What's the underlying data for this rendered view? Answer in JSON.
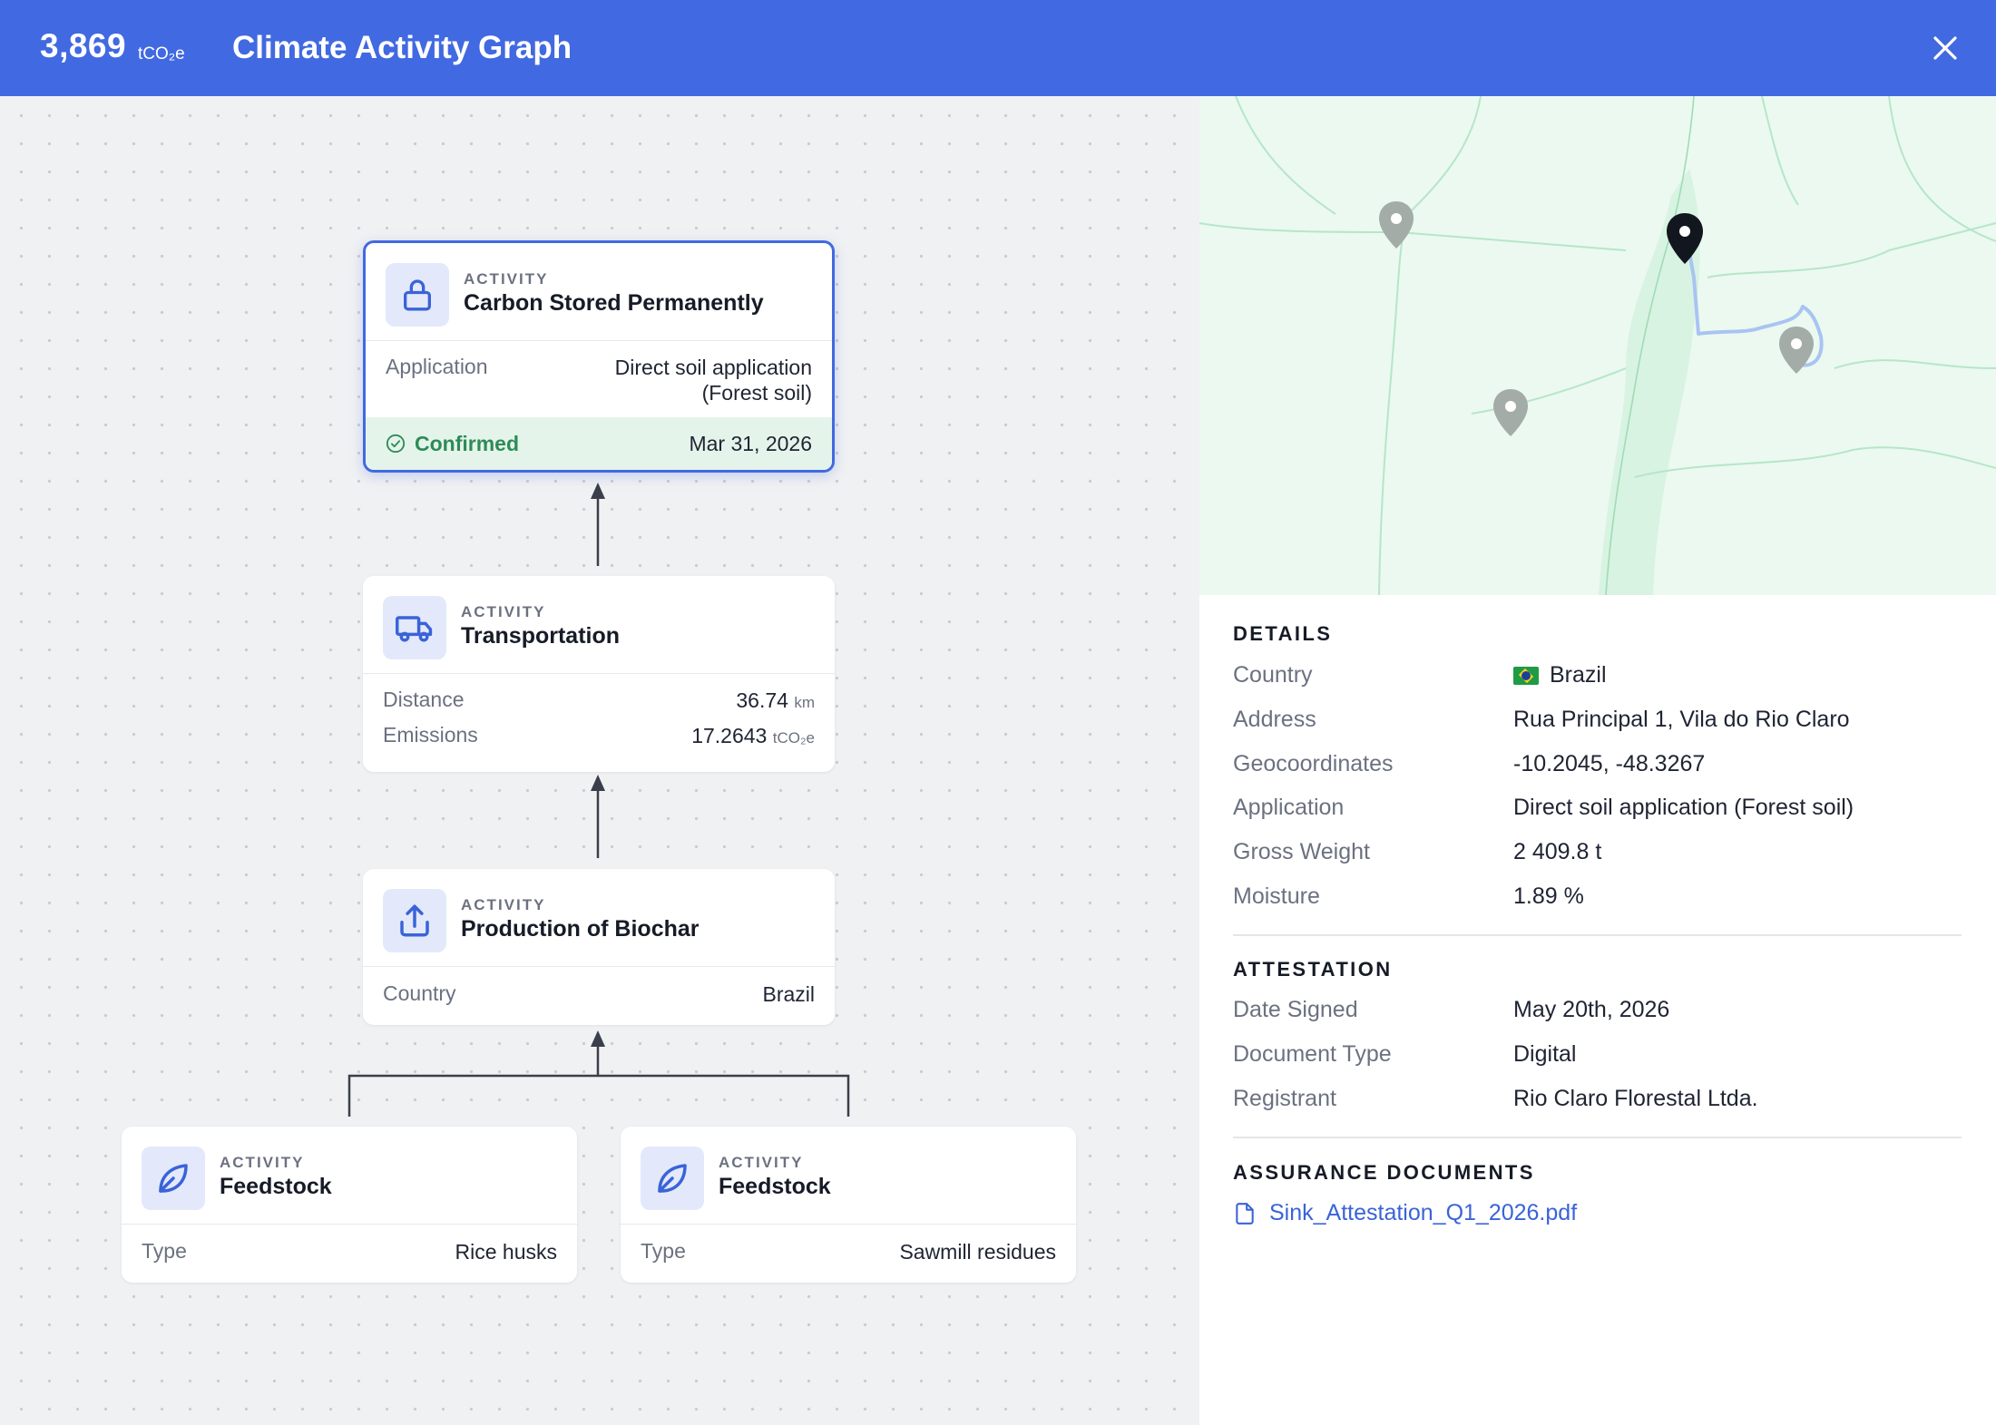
{
  "header": {
    "total_value": "3,869",
    "total_unit": "tCO₂e",
    "title": "Climate Activity Graph",
    "close_icon": "close-icon"
  },
  "colors": {
    "header_bg": "#4169e1",
    "accent": "#4169e1",
    "confirmed": "#2e8b57",
    "link": "#3a63d8"
  },
  "graph": {
    "kicker": "ACTIVITY",
    "nodes": {
      "carbon": {
        "title": "Carbon Stored Permanently",
        "icon": "lock-icon",
        "row_label": "Application",
        "row_value_line1": "Direct soil application",
        "row_value_line2": "(Forest soil)",
        "status": "Confirmed",
        "status_icon": "check-circle-icon",
        "date": "Mar 31, 2026"
      },
      "transport": {
        "title": "Transportation",
        "icon": "truck-icon",
        "distance_label": "Distance",
        "distance_value": "36.74",
        "distance_unit": "km",
        "emissions_label": "Emissions",
        "emissions_value": "17.2643",
        "emissions_unit": "tCO₂e"
      },
      "biochar": {
        "title": "Production of Biochar",
        "icon": "upload-icon",
        "row_label": "Country",
        "row_value": "Brazil"
      },
      "feedstock_1": {
        "title": "Feedstock",
        "icon": "leaf-icon",
        "row_label": "Type",
        "row_value": "Rice husks"
      },
      "feedstock_2": {
        "title": "Feedstock",
        "icon": "leaf-icon",
        "row_label": "Type",
        "row_value": "Sawmill residues"
      }
    }
  },
  "details": {
    "title": "DETAILS",
    "country_label": "Country",
    "country_value": "Brazil",
    "address_label": "Address",
    "address_value": "Rua Principal 1, Vila do Rio Claro",
    "geo_label": "Geocoordinates",
    "geo_value": "-10.2045, -48.3267",
    "application_label": "Application",
    "application_value": "Direct soil application (Forest soil)",
    "weight_label": "Gross Weight",
    "weight_value": "2 409.8 t",
    "moisture_label": "Moisture",
    "moisture_value": "1.89 %"
  },
  "attestation": {
    "title": "ATTESTATION",
    "date_label": "Date Signed",
    "date_value": "May 20th, 2026",
    "doctype_label": "Document Type",
    "doctype_value": "Digital",
    "registrant_label": "Registrant",
    "registrant_value": "Rio Claro Florestal Ltda."
  },
  "assurance": {
    "title": "ASSURANCE DOCUMENTS",
    "document_name": "Sink_Attestation_Q1_2026.pdf",
    "document_icon": "file-icon"
  }
}
